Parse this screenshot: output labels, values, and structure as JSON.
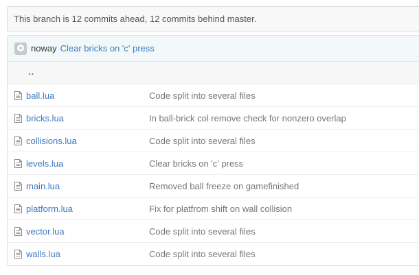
{
  "branch_status": "This branch is 12 commits ahead, 12 commits behind master.",
  "latest_commit": {
    "author": "noway",
    "message": "Clear bricks on 'c' press"
  },
  "parent_link": "..",
  "files": [
    {
      "name": "ball.lua",
      "message": "Code split into several files"
    },
    {
      "name": "bricks.lua",
      "message": "In ball-brick col remove check for nonzero overlap"
    },
    {
      "name": "collisions.lua",
      "message": "Code split into several files"
    },
    {
      "name": "levels.lua",
      "message": "Clear bricks on 'c' press"
    },
    {
      "name": "main.lua",
      "message": "Removed ball freeze on gamefinished"
    },
    {
      "name": "platform.lua",
      "message": "Fix for platfrom shift on wall collision"
    },
    {
      "name": "vector.lua",
      "message": "Code split into several files"
    },
    {
      "name": "walls.lua",
      "message": "Code split into several files"
    }
  ]
}
